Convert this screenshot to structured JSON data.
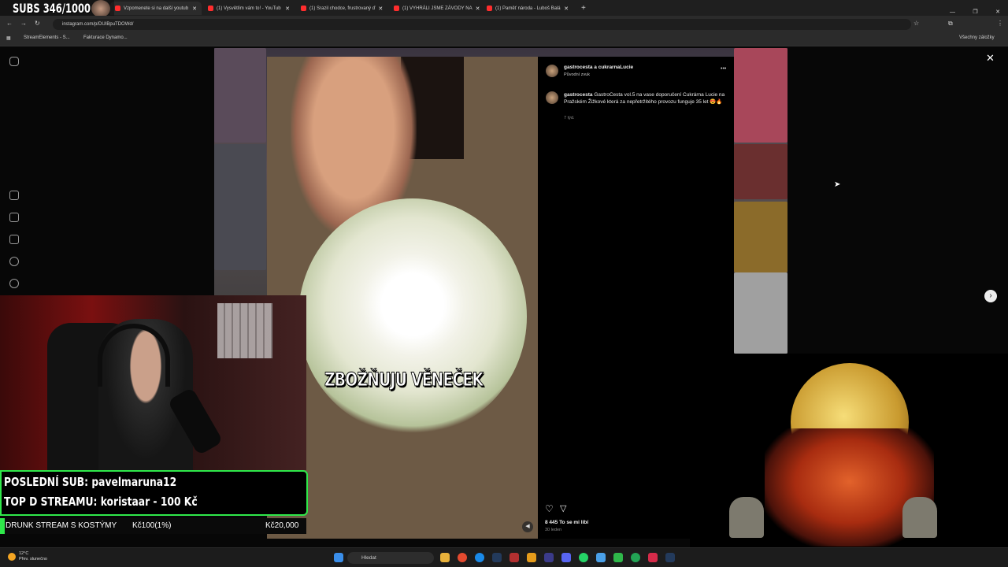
{
  "browser": {
    "tabs": [
      {
        "label": "Vzpomenete si na další youtub",
        "active": true
      },
      {
        "label": "(1) Vysvětlím vám to! - YouTub"
      },
      {
        "label": "(1) Srazil chodce, frustrovaný ď"
      },
      {
        "label": "(1) VYHRÁLI JSME ZÁVODY NA"
      },
      {
        "label": "(1) Paměť národa - Luboš Balá"
      }
    ],
    "new_tab": "+",
    "url": "instagram.com/p/DUIBpuTDOWd/",
    "bookmarks": [
      "StreamElements - S...",
      "Fakturace Dynamo..."
    ],
    "all_bookmarks": "Všechny záložky"
  },
  "post": {
    "author": "gastrocesta a cukrarnaLucie",
    "audio": "Původní zvuk",
    "caption_user": "gastrocesta",
    "caption_text": "GastroCesta vol.5 na vase doporučení Cukrárna Lucie na Pražském Žižkové která za nepřetržitého provozu funguje 35 let 😍🔥",
    "caption_age": "7 týd.",
    "likes": "8 445 To se mi líbí",
    "date": "30 leden",
    "video_caption": "ZBOŽŇUJU VĚNEČEK",
    "more": "•••"
  },
  "stream": {
    "subs_counter": "SUBS 346/1000",
    "last_sub": "POSLEDNÍ SUB: pavelmaruna12",
    "top_donor": "TOP D STREAMU: koristaar - 100 Kč",
    "goal_name": "DRUNK STREAM S KOSTÝMY",
    "goal_progress": "Kč100(1%)",
    "goal_target": "Kč20,000",
    "goal_fraction": 0.01,
    "accent": "#2fe84a"
  },
  "taskbar": {
    "temperature": "12°C",
    "weather": "Přev. slunečno",
    "search": "Hledat"
  }
}
